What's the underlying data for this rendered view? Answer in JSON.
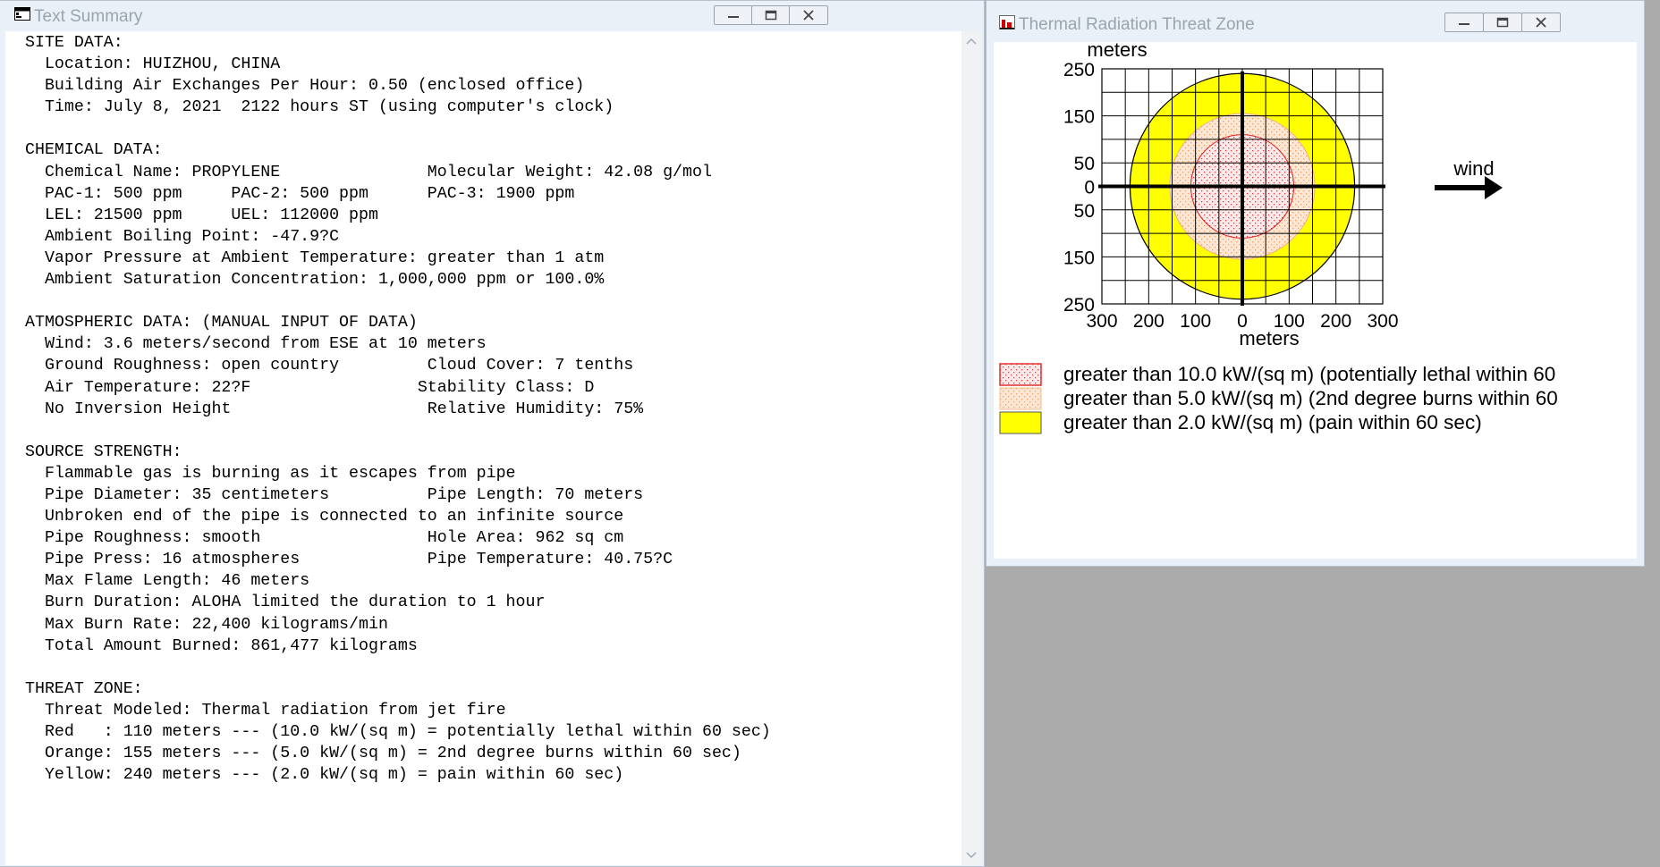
{
  "summary_window": {
    "title": "Text Summary",
    "lines": [
      "SITE DATA:",
      "  Location: HUIZHOU, CHINA",
      "  Building Air Exchanges Per Hour: 0.50 (enclosed office)",
      "  Time: July 8, 2021  2122 hours ST (using computer's clock)",
      "",
      "CHEMICAL DATA:",
      "  Chemical Name: PROPYLENE               Molecular Weight: 42.08 g/mol",
      "  PAC-1: 500 ppm     PAC-2: 500 ppm      PAC-3: 1900 ppm",
      "  LEL: 21500 ppm     UEL: 112000 ppm",
      "  Ambient Boiling Point: -47.9?C",
      "  Vapor Pressure at Ambient Temperature: greater than 1 atm",
      "  Ambient Saturation Concentration: 1,000,000 ppm or 100.0%",
      "",
      "ATMOSPHERIC DATA: (MANUAL INPUT OF DATA)",
      "  Wind: 3.6 meters/second from ESE at 10 meters",
      "  Ground Roughness: open country         Cloud Cover: 7 tenths",
      "  Air Temperature: 22?F                 Stability Class: D",
      "  No Inversion Height                    Relative Humidity: 75%",
      "",
      "SOURCE STRENGTH:",
      "  Flammable gas is burning as it escapes from pipe",
      "  Pipe Diameter: 35 centimeters          Pipe Length: 70 meters",
      "  Unbroken end of the pipe is connected to an infinite source",
      "  Pipe Roughness: smooth                 Hole Area: 962 sq cm",
      "  Pipe Press: 16 atmospheres             Pipe Temperature: 40.75?C",
      "  Max Flame Length: 46 meters",
      "  Burn Duration: ALOHA limited the duration to 1 hour",
      "  Max Burn Rate: 22,400 kilograms/min",
      "  Total Amount Burned: 861,477 kilograms",
      "",
      "THREAT ZONE:",
      "  Threat Modeled: Thermal radiation from jet fire",
      "  Red   : 110 meters --- (10.0 kW/(sq m) = potentially lethal within 60 sec)",
      "  Orange: 155 meters --- (5.0 kW/(sq m) = 2nd degree burns within 60 sec)",
      "  Yellow: 240 meters --- (2.0 kW/(sq m) = pain within 60 sec)"
    ]
  },
  "threat_window": {
    "title": "Thermal Radiation Threat Zone",
    "wind_label": "wind",
    "legend": [
      {
        "label": "greater than 10.0 kW/(sq m) (potentially lethal within 60",
        "color": "#f7d3d3",
        "border": "#e03030",
        "pattern": "dots-red"
      },
      {
        "label": "greater than 5.0 kW/(sq m) (2nd degree burns within 60",
        "color": "#fbdcc0",
        "border": "#f0b070",
        "pattern": "dots-orange"
      },
      {
        "label": "greater than 2.0 kW/(sq m) (pain within 60 sec)",
        "color": "#ffff00",
        "border": "#606000",
        "pattern": "solid"
      }
    ]
  },
  "chart_data": {
    "type": "scatter",
    "title": "",
    "xlabel": "meters",
    "ylabel": "meters",
    "xlim": [
      -300,
      300
    ],
    "ylim": [
      -250,
      250
    ],
    "x_ticks": [
      -300,
      -200,
      -100,
      0,
      100,
      200,
      300
    ],
    "x_tick_labels": [
      "300",
      "200",
      "100",
      "0",
      "100",
      "200",
      "300"
    ],
    "y_ticks": [
      250,
      150,
      50,
      0,
      -50,
      -150,
      -250
    ],
    "y_tick_labels": [
      "250",
      "150",
      "50",
      "0",
      "50",
      "150",
      "250"
    ],
    "grid": true,
    "zones": [
      {
        "name": "Yellow",
        "radius_m": 240,
        "color": "#ffff00"
      },
      {
        "name": "Orange",
        "radius_m": 155,
        "color": "#fbdcc0"
      },
      {
        "name": "Red",
        "radius_m": 110,
        "color": "#f7d3d3"
      }
    ]
  }
}
